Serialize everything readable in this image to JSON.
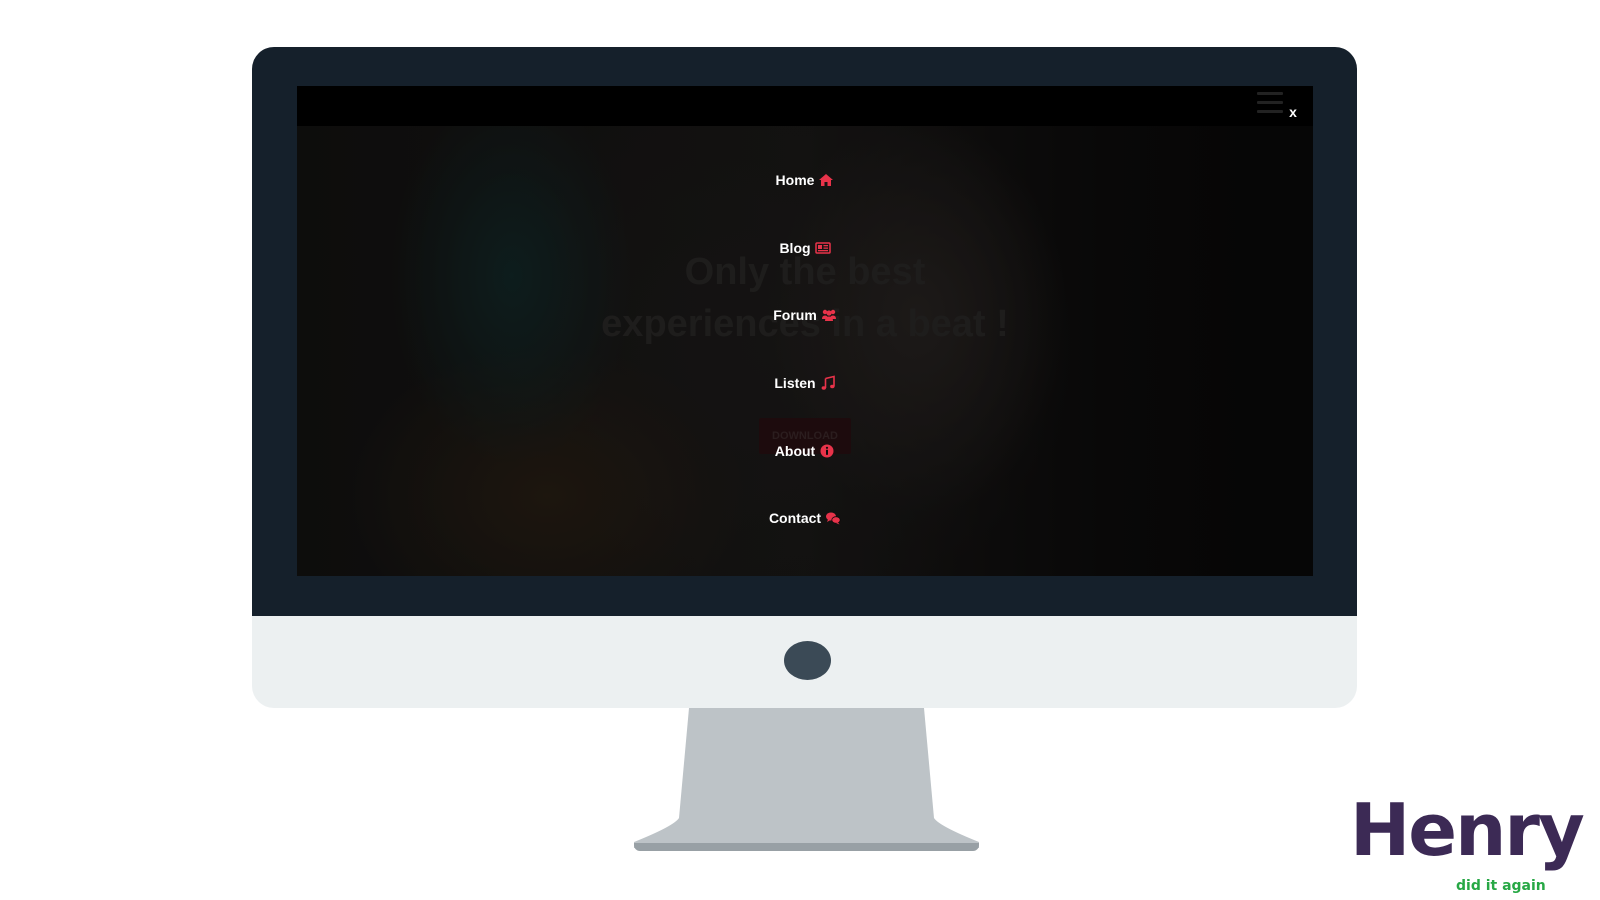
{
  "hero": {
    "headline": "Only the best experiences in a beat !",
    "cta_label": "DOWNLOAD"
  },
  "nav": {
    "close_label": "x",
    "menu_items": [
      {
        "label": "Home",
        "icon": "home-icon"
      },
      {
        "label": "Blog",
        "icon": "newspaper-icon"
      },
      {
        "label": "Forum",
        "icon": "users-icon"
      },
      {
        "label": "Listen",
        "icon": "music-icon"
      },
      {
        "label": "About",
        "icon": "info-circle-icon"
      },
      {
        "label": "Contact",
        "icon": "chat-bubbles-icon"
      }
    ]
  },
  "branding": {
    "logo_text": "Henry",
    "tagline": "did it again"
  },
  "colors": {
    "accent": "#e8334a",
    "bezel": "#15202b",
    "chin": "#ecf0f1",
    "stand": "#bdc3c7",
    "logo_purple": "#3c2a55",
    "logo_green": "#27a845"
  }
}
